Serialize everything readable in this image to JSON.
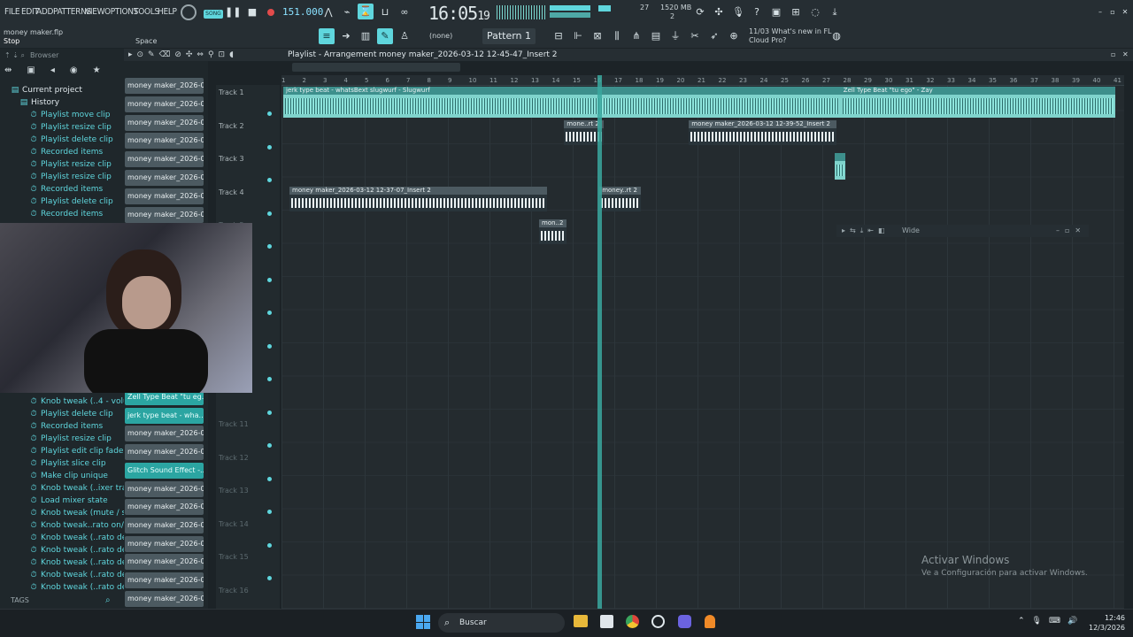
{
  "menu": [
    "FILE",
    "EDIT",
    "ADD",
    "PATTERNS",
    "VIEW",
    "OPTIONS",
    "TOOLS",
    "HELP"
  ],
  "transport": {
    "song_label": "SONG",
    "tempo": "151.000",
    "clock": "16:05",
    "clock_small": "19",
    "cpu_a": "27",
    "cpu_mem": "1520 MB",
    "cpu_b": "2"
  },
  "project": {
    "file": "money maker.flp",
    "hint": "Stop",
    "hint_key": "Space"
  },
  "toolbar": {
    "pattern": "Pattern 1",
    "none": "(none)",
    "news_date": "11/03",
    "news_text": "What's new in FL",
    "news_text2": "Cloud Pro?"
  },
  "browser": {
    "title": "Browser",
    "top_items": [
      {
        "label": "Current project",
        "icon": "folder-icon"
      },
      {
        "label": "History",
        "icon": "folder-icon"
      },
      {
        "label": "Playlist move clip",
        "icon": "history-icon"
      },
      {
        "label": "Playlist resize clip",
        "icon": "history-icon"
      },
      {
        "label": "Playlist delete clip",
        "icon": "history-icon"
      },
      {
        "label": "Recorded items",
        "icon": "history-icon"
      },
      {
        "label": "Playlist resize clip",
        "icon": "history-icon"
      },
      {
        "label": "Playlist resize clip",
        "icon": "history-icon"
      },
      {
        "label": "Recorded items",
        "icon": "history-icon"
      },
      {
        "label": "Playlist delete clip",
        "icon": "history-icon"
      },
      {
        "label": "Recorded items",
        "icon": "history-icon"
      }
    ],
    "bottom_items": [
      "Knob tweak (..4 - volume)",
      "Playlist delete clip",
      "Recorded items",
      "Playlist resize clip",
      "Playlist edit clip fade",
      "Playlist slice clip",
      "Make clip unique",
      "Knob tweak (..ixer track)",
      "Load mixer state",
      "Knob tweak (mute / solo)",
      "Knob tweak..rato on/off)",
      "Knob tweak (..rato depth)",
      "Knob tweak (..rato depth)",
      "Knob tweak (..rato depth)",
      "Knob tweak (..rato depth)",
      "Knob tweak (..rato depth)"
    ],
    "tags": "TAGS"
  },
  "channels": [
    {
      "label": "money maker_2026-03-...",
      "teal": false
    },
    {
      "label": "money maker_2026-03-...",
      "teal": false
    },
    {
      "label": "money maker_2026-03-...",
      "teal": false
    },
    {
      "label": "money maker_2026-03-...",
      "teal": false
    },
    {
      "label": "money maker_2026-03-...",
      "teal": false
    },
    {
      "label": "money maker_2026-03-...",
      "teal": false
    },
    {
      "label": "money maker_2026-03-...",
      "teal": false
    },
    {
      "label": "money maker_2026-03-...",
      "teal": false
    }
  ],
  "channels_bottom": [
    {
      "label": "Zell Type Beat \"tu eg...",
      "teal": true
    },
    {
      "label": "jerk type beat - wha...",
      "teal": true
    },
    {
      "label": "money maker_2026-03-...",
      "teal": false
    },
    {
      "label": "money maker_2026-03-...",
      "teal": false
    },
    {
      "label": "Glitch Sound Effect -...",
      "teal": true
    },
    {
      "label": "money maker_2026-03-...",
      "teal": false
    },
    {
      "label": "money maker_2026-03-...",
      "teal": false
    },
    {
      "label": "money maker_2026-03-...",
      "teal": false
    },
    {
      "label": "money maker_2026-03-...",
      "teal": false
    },
    {
      "label": "money maker_2026-03-...",
      "teal": false
    },
    {
      "label": "money maker_2026-03-...",
      "teal": false
    },
    {
      "label": "money maker_2026-03-...",
      "teal": false
    }
  ],
  "playlist": {
    "title": "Playlist - Arrangement",
    "pattern": "money maker_2026-03-12 12-45-47_Insert 2",
    "ruler": [
      "1",
      "2",
      "3",
      "4",
      "5",
      "6",
      "7",
      "8",
      "9",
      "10",
      "11",
      "12",
      "13",
      "14",
      "15",
      "16",
      "17",
      "18",
      "19",
      "20",
      "21",
      "22",
      "23",
      "24",
      "25",
      "26",
      "27",
      "28",
      "29",
      "30",
      "31",
      "32",
      "33",
      "34",
      "35",
      "36",
      "37",
      "38",
      "39",
      "40",
      "41"
    ],
    "tracks": [
      {
        "label": "Track 1",
        "dim": false
      },
      {
        "label": "Track 2",
        "dim": false
      },
      {
        "label": "Track 3",
        "dim": false
      },
      {
        "label": "Track 4",
        "dim": false
      },
      {
        "label": "Track 5",
        "dim": true
      },
      {
        "label": "",
        "dim": true
      },
      {
        "label": "",
        "dim": true
      },
      {
        "label": "",
        "dim": true
      },
      {
        "label": "",
        "dim": true
      },
      {
        "label": "",
        "dim": true
      },
      {
        "label": "Track 11",
        "dim": true
      },
      {
        "label": "Track 12",
        "dim": true
      },
      {
        "label": "Track 13",
        "dim": true
      },
      {
        "label": "Track 14",
        "dim": true
      },
      {
        "label": "Track 15",
        "dim": true
      },
      {
        "label": "Track 16",
        "dim": true
      }
    ],
    "clips": [
      {
        "label": "jerk type beat - whatsBext slugwurf - Slugwurf",
        "track": 0,
        "start": 1,
        "end": 27.8,
        "style": "teal"
      },
      {
        "label": "Zell Type Beat \"tu ego\" - Zay",
        "track": 0,
        "start": 27.8,
        "end": 41,
        "style": "teal"
      },
      {
        "label": "mone..rt 2",
        "track": 1,
        "start": 14.5,
        "end": 16.4,
        "style": "dark"
      },
      {
        "label": "money maker_2026-03-12 12-39-52_Insert 2",
        "track": 1,
        "start": 20.5,
        "end": 27.6,
        "style": "dark"
      },
      {
        "label": "",
        "track": 2,
        "start": 27.5,
        "end": 28,
        "style": "teal"
      },
      {
        "label": "money maker_2026-03-12 12-37-07_Insert 2",
        "track": 3,
        "start": 1.3,
        "end": 13.7,
        "style": "dark"
      },
      {
        "label": "money..rt 2",
        "track": 3,
        "start": 16.2,
        "end": 18.2,
        "style": "dark"
      },
      {
        "label": "mon..2",
        "track": 4,
        "start": 13.3,
        "end": 14.6,
        "style": "dark"
      }
    ],
    "playhead_bar": 16.2
  },
  "mixer_float": {
    "label": "Wide"
  },
  "watermark": {
    "line1": "Activar Windows",
    "line2": "Ve a Configuración para activar Windows."
  },
  "taskbar": {
    "search": "Buscar",
    "time": "12:46",
    "date": "12/3/2026"
  }
}
